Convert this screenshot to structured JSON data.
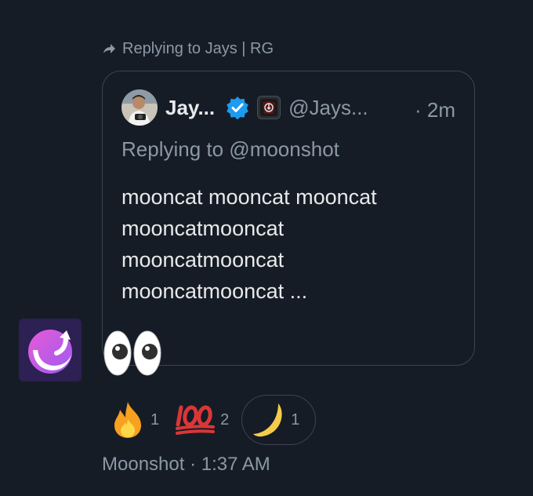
{
  "reply_header": {
    "text": "Replying to Jays | RG",
    "icon": "reply-arrow-icon"
  },
  "quote": {
    "author_name": "Jay...",
    "author_handle": "@Jays...",
    "time": "· 2m",
    "replying_to": "Replying to @moonshot",
    "body_lines": [
      "mooncat mooncat mooncat",
      "mooncatmooncat",
      "mooncatmooncat",
      "mooncatmooncat ..."
    ],
    "icons": [
      "avatar",
      "verified-badge-icon",
      "affiliate-badge-icon"
    ]
  },
  "message": {
    "emoji": "eyes",
    "app_avatar_icon": "moonshot-logo-icon"
  },
  "reactions": [
    {
      "emoji": "fire",
      "count": "1"
    },
    {
      "emoji": "hundred-points",
      "count": "2"
    },
    {
      "emoji": "crescent-moon",
      "count": "1",
      "selected": true
    }
  ],
  "footer": {
    "text": "Moonshot · 1:37 AM"
  },
  "colors": {
    "background": "#161c26",
    "text_primary": "#e7e9ea",
    "text_secondary": "#8b98a5",
    "border": "#3b4450",
    "verified_blue": "#1d9bf0"
  }
}
